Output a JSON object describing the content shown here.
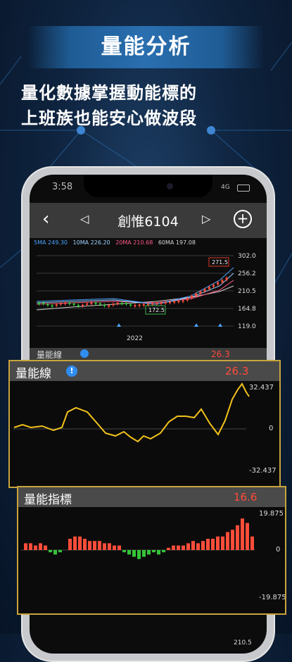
{
  "banner": {
    "title": "量能分析"
  },
  "headline": {
    "line1": "量化數據掌握動能標的",
    "line2": "上班族也能安心做波段"
  },
  "phone": {
    "time": "3:58",
    "signal": "4G",
    "stock_title": "創惟6104",
    "ma_legend": [
      {
        "label": "5MA 249.30",
        "color": "#4aa3ff"
      },
      {
        "label": "10MA 226.20",
        "color": "#9fd3ff"
      },
      {
        "label": "20MA 210.68",
        "color": "#ff5a8a"
      },
      {
        "label": "60MA 197.08",
        "color": "#d7d7d7"
      }
    ],
    "price_axis": [
      "302.0",
      "256.2",
      "210.5",
      "164.8",
      "119.0"
    ],
    "year_label": "2022",
    "annotation_high": "271.5",
    "annotation_low": "172.5",
    "mini_panel_title": "量能線",
    "mini_panel_value": "26.3",
    "bottom_axis": "210.5"
  },
  "volume_line_panel": {
    "title": "量能線",
    "value": "26.3",
    "axis": [
      "32.437",
      "0",
      "-32.437"
    ],
    "line_color": "#f2c21b"
  },
  "volume_index_panel": {
    "title": "量能指標",
    "value": "16.6",
    "axis": [
      "19.875",
      "0",
      "-19.875"
    ],
    "up_color": "#ff4d3a",
    "down_color": "#35c437"
  }
}
